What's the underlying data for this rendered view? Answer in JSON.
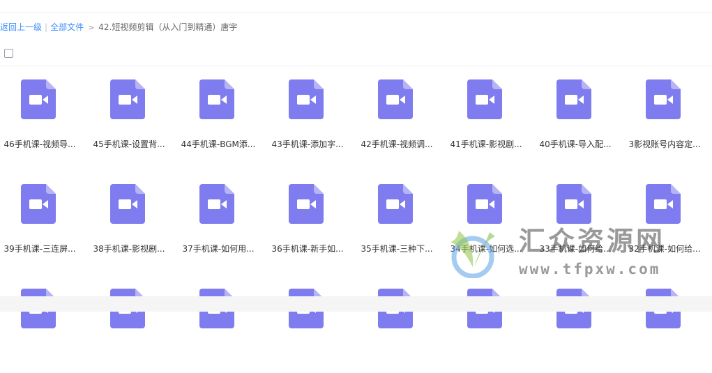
{
  "breadcrumb": {
    "back_label": "返回上一级",
    "separator": "|",
    "all_files_label": "全部文件",
    "arrow": ">",
    "current_folder": "42.短视频剪辑（从入门到精通）唐宇"
  },
  "files": [
    {
      "name": "46手机课-视频导..."
    },
    {
      "name": "45手机课-设置背..."
    },
    {
      "name": "44手机课-BGM添..."
    },
    {
      "name": "43手机课-添加字..."
    },
    {
      "name": "42手机课-视频调..."
    },
    {
      "name": "41手机课-影视剧..."
    },
    {
      "name": "40手机课-导入配..."
    },
    {
      "name": "3影视账号内容定..."
    },
    {
      "name": "39手机课-三连屏..."
    },
    {
      "name": "38手机课-影视剧..."
    },
    {
      "name": "37手机课-如何用..."
    },
    {
      "name": "36手机课-新手如..."
    },
    {
      "name": "35手机课-三种下..."
    },
    {
      "name": "34手机课-如何选..."
    },
    {
      "name": "33手机课-如何给..."
    },
    {
      "name": "32手机课-如何给..."
    },
    {
      "name": ""
    },
    {
      "name": ""
    },
    {
      "name": ""
    },
    {
      "name": ""
    },
    {
      "name": ""
    },
    {
      "name": ""
    },
    {
      "name": ""
    },
    {
      "name": ""
    }
  ],
  "icons": {
    "file_icon": "video-file-icon",
    "checkbox": "checkbox-icon"
  },
  "colors": {
    "link": "#3b8cff",
    "video_icon": "#7f7cf0",
    "video_icon_fold": "#b6b3f7"
  },
  "watermark": {
    "title": "汇众资源网",
    "url": "www.tfpxw.com"
  }
}
